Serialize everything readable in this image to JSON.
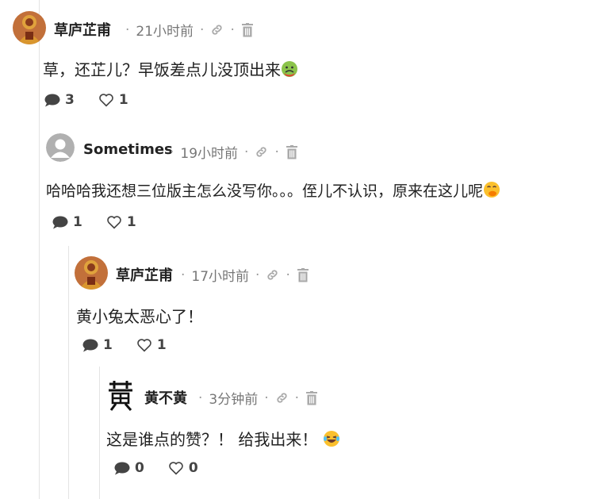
{
  "comments": [
    {
      "author": "草庐芷甫",
      "time": "21小时前",
      "text": "草，还芷儿？早饭差点儿没顶出来",
      "reply_count": "3",
      "like_count": "1",
      "avatar": "buddha-statue-avatar",
      "emoji": "nauseated-face-emoji"
    },
    {
      "author": "Sometimes",
      "time": "19小时前",
      "text": "哈哈哈我还想三位版主怎么没写你。。。侄儿不认识，原来在这儿呢",
      "reply_count": "1",
      "like_count": "1",
      "avatar": "default-user-avatar",
      "emoji": "hand-over-mouth-emoji"
    },
    {
      "author": "草庐芷甫",
      "time": "17小时前",
      "text": "黄小兔太恶心了！",
      "reply_count": "1",
      "like_count": "1",
      "avatar": "buddha-statue-avatar"
    },
    {
      "author": "黄不黄",
      "time": "3分钟前",
      "text": "这是谁点的赞？！ 给我出来！",
      "reply_count": "0",
      "like_count": "0",
      "avatar": "calligraphy-avatar",
      "emoji": "laughing-tears-emoji"
    }
  ],
  "colors": {
    "meta": "#777777",
    "icon": "#999999",
    "thread_line": "#e4e4e4",
    "text": "#222222"
  }
}
